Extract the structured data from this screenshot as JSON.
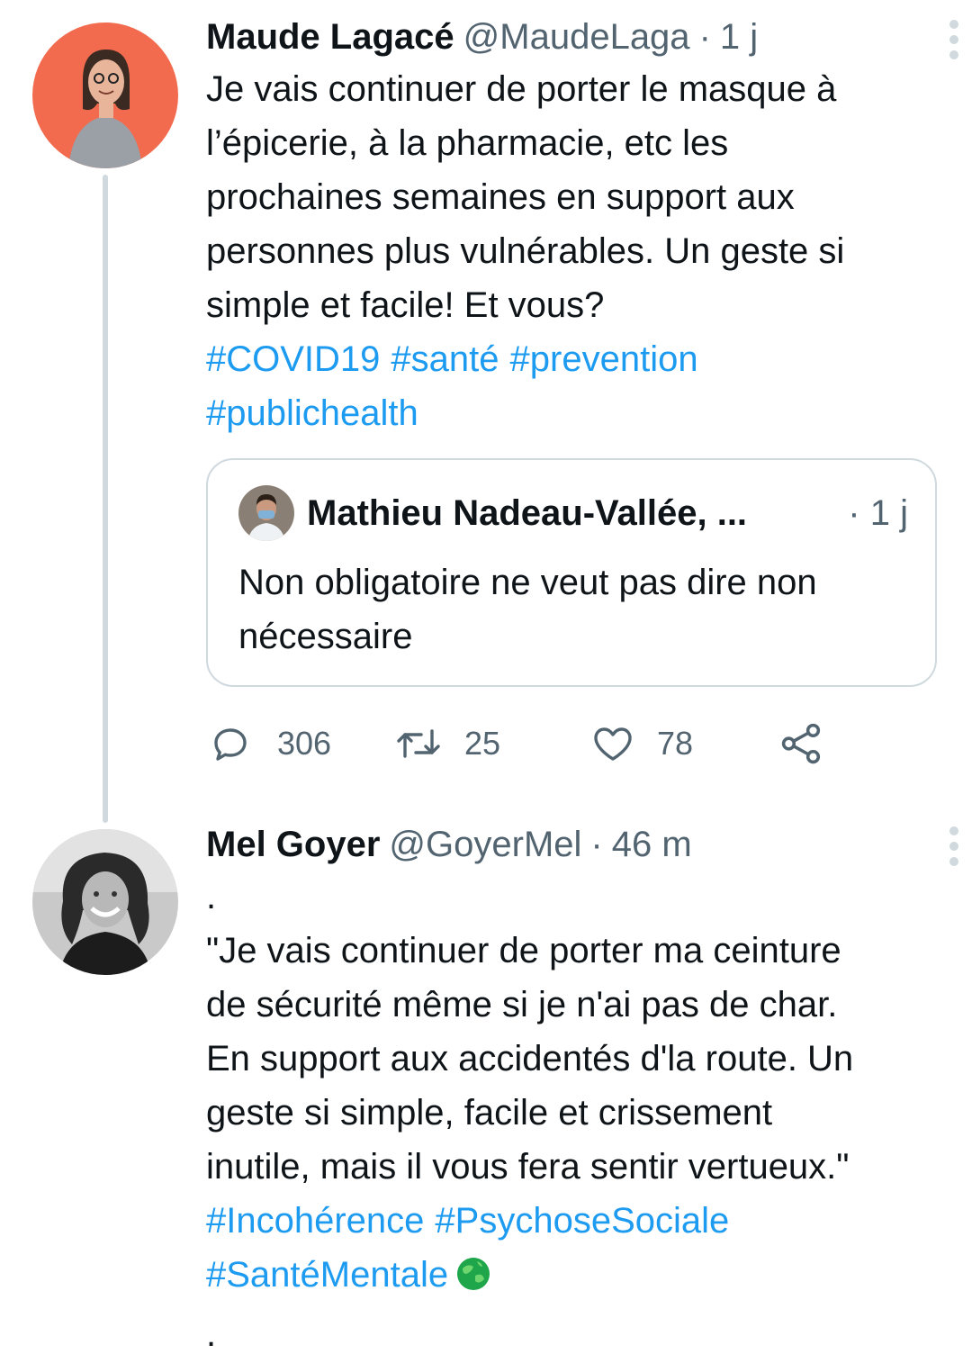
{
  "tweet1": {
    "display_name": "Maude Lagacé",
    "handle": "@MaudeLaga",
    "separator": "·",
    "time": "1 j",
    "text": "Je vais continuer de porter le masque à\nl’épicerie, à la pharmacie, etc les\nprochaines semaines en support aux\npersonnes plus vulnérables. Un geste si\nsimple et facile! Et vous?",
    "hashtags_line1": [
      "#COVID19",
      "#santé",
      "#prevention"
    ],
    "hashtags_line2": [
      "#publichealth"
    ],
    "avatar_color": "#f26b4e",
    "more_icon": "more-vertical-icon"
  },
  "quote": {
    "display_name": "Mathieu Nadeau-Vallée, ...",
    "separator": "·",
    "time": "1 j",
    "text": "Non obligatoire ne veut pas dire non\nnécessaire"
  },
  "actions": {
    "reply_count": "306",
    "retweet_count": "25",
    "like_count": "78",
    "icons": [
      "reply-icon",
      "retweet-icon",
      "like-icon",
      "share-icon"
    ]
  },
  "tweet2": {
    "display_name": "Mel Goyer",
    "handle": "@GoyerMel",
    "separator": "·",
    "time": "46 m",
    "leading_dot": ".",
    "text": "\"Je vais continuer de porter ma ceinture\nde sécurité même si je n'ai pas de char.\nEn support aux accidentés d'la route. Un\ngeste si simple, facile et crissement\ninutile, mais il vous fera sentir vertueux.\"",
    "hashtags_line1": [
      "#Incohérence",
      "#PsychoseSociale"
    ],
    "hashtags_line2": [
      "#SantéMentale"
    ],
    "emoji": "🌍",
    "trailing_dot": "."
  },
  "colors": {
    "link": "#1d9bf0",
    "secondary_text": "#536471",
    "border": "#cfd9de"
  }
}
